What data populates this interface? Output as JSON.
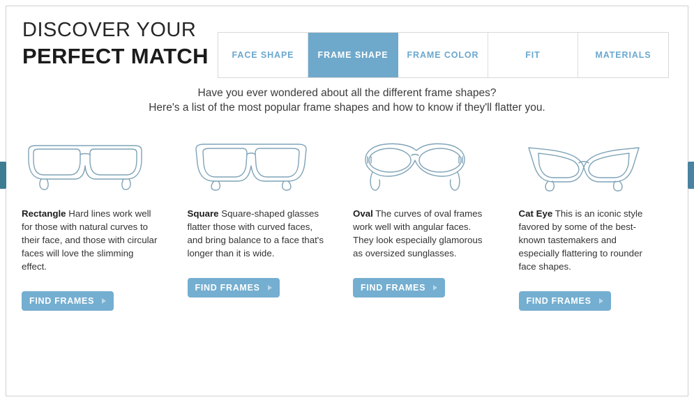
{
  "header": {
    "title_line1": "DISCOVER YOUR",
    "title_line2": "PERFECT MATCH"
  },
  "tabs": [
    {
      "label": "FACE SHAPE",
      "active": false
    },
    {
      "label": "FRAME SHAPE",
      "active": true
    },
    {
      "label": "FRAME COLOR",
      "active": false
    },
    {
      "label": "FIT",
      "active": false
    },
    {
      "label": "MATERIALS",
      "active": false
    }
  ],
  "intro": {
    "line1": "Have you ever wondered about all the different frame shapes?",
    "line2": "Here's a list of the most popular frame shapes and how to know if they'll flatter you."
  },
  "columns": [
    {
      "icon": "rectangle-glasses-icon",
      "name": "Rectangle",
      "description": "Hard lines work well for those with natural curves to their face, and those with circular faces will love the slimming effect.",
      "button_label": "FIND FRAMES"
    },
    {
      "icon": "square-glasses-icon",
      "name": "Square",
      "description": "Square-shaped glasses flatter those with curved faces, and bring balance to a face that's longer than it is wide.",
      "button_label": "FIND FRAMES"
    },
    {
      "icon": "oval-glasses-icon",
      "name": "Oval",
      "description": "The curves of oval frames work well with angular faces. They look especially glamorous as oversized sunglasses.",
      "button_label": "FIND FRAMES"
    },
    {
      "icon": "cat-eye-glasses-icon",
      "name": "Cat Eye",
      "description": "This is an iconic style favored by some of the best-known tastemakers and especially flattering to rounder face shapes.",
      "button_label": "FIND FRAMES"
    }
  ],
  "carousel": {
    "prev_label": "",
    "next_label": ""
  },
  "colors": {
    "accent_blue": "#6ea8cb",
    "button_blue": "#74aed0",
    "tab_text_blue": "#6aa8cf",
    "edge_tab_teal": "#3e7c93",
    "frame_line": "#7a9fb3"
  }
}
